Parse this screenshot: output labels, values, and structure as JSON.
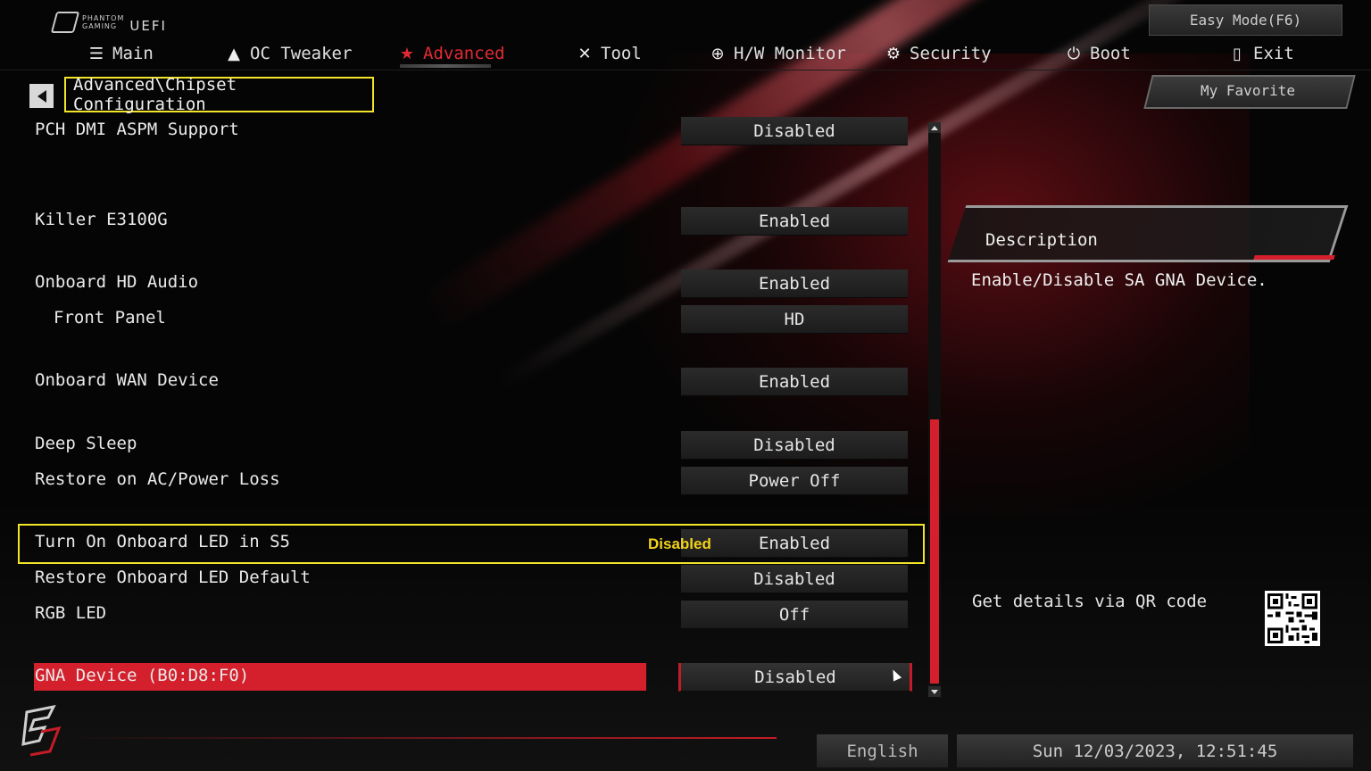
{
  "header": {
    "logo_line1": "PHANTOM",
    "logo_line2": "GAMING",
    "logo_uefi": "UEFI",
    "easy_mode_label": "Easy Mode(F6)"
  },
  "nav": {
    "tabs": [
      {
        "label": "Main",
        "icon": "list-icon"
      },
      {
        "label": "OC Tweaker",
        "icon": "rocket-icon"
      },
      {
        "label": "Advanced",
        "icon": "star-icon",
        "active": true
      },
      {
        "label": "Tool",
        "icon": "tools-icon"
      },
      {
        "label": "H/W Monitor",
        "icon": "monitor-icon"
      },
      {
        "label": "Security",
        "icon": "shield-icon"
      },
      {
        "label": "Boot",
        "icon": "power-icon"
      },
      {
        "label": "Exit",
        "icon": "exit-icon"
      }
    ]
  },
  "breadcrumb": "Advanced\\Chipset Configuration",
  "favorite_label": "My Favorite",
  "settings": [
    {
      "label": "PCH DMI ASPM Support",
      "value": "Disabled"
    },
    {
      "label": "Killer E3100G",
      "value": "Enabled"
    },
    {
      "label": "Onboard HD Audio",
      "value": "Enabled"
    },
    {
      "label": "Front Panel",
      "value": "HD"
    },
    {
      "label": "Onboard WAN Device",
      "value": "Enabled"
    },
    {
      "label": "Deep Sleep",
      "value": "Disabled"
    },
    {
      "label": "Restore on AC/Power Loss",
      "value": "Power Off"
    },
    {
      "label": "Turn On Onboard LED in S5",
      "value": "Enabled"
    },
    {
      "label": "Restore Onboard LED Default",
      "value": "Disabled"
    },
    {
      "label": "RGB LED",
      "value": "Off"
    },
    {
      "label": "GNA Device (B0:D8:F0)",
      "value": "Disabled",
      "selected": true
    }
  ],
  "annotation_note": "Disabled",
  "description": {
    "title": "Description",
    "text": "Enable/Disable SA GNA Device."
  },
  "qr_label": "Get details via QR code",
  "footer": {
    "language": "English",
    "datetime": "Sun 12/03/2023, 12:51:45"
  },
  "colors": {
    "accent_red": "#d4202c",
    "annotation_yellow": "#f3e52a"
  }
}
